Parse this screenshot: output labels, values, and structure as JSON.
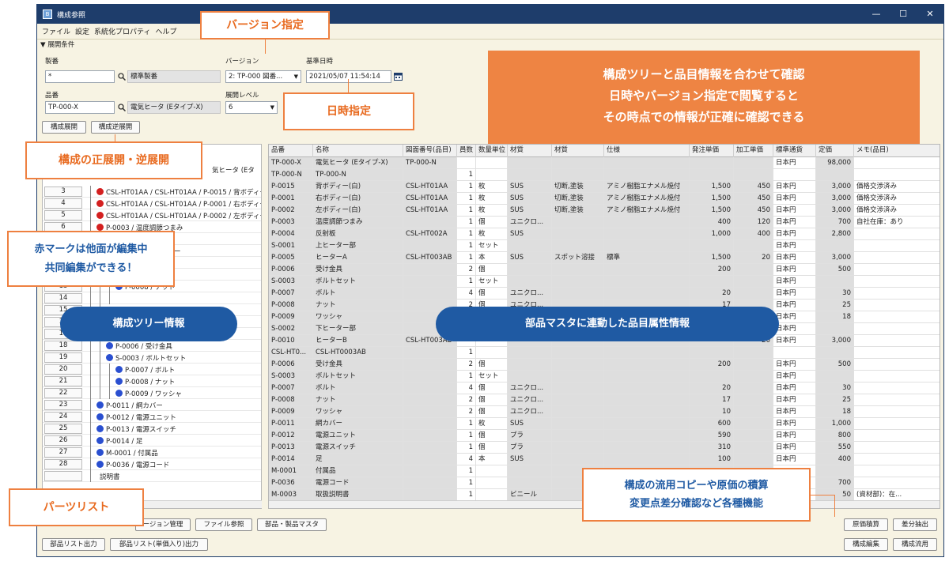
{
  "window": {
    "title": "構成参照",
    "app_icon": "app-icon",
    "controls": [
      "—",
      "☐",
      "✕"
    ]
  },
  "menu": [
    "ファイル",
    "設定",
    "系統化プロパティ",
    "ヘルプ"
  ],
  "filter_section": {
    "header": "▼ 展開条件",
    "seiban_label": "製番",
    "seiban_value": "*",
    "seiban_desc": "標準製番",
    "hinban_label": "品番",
    "hinban_value": "TP-000-X",
    "hinban_desc": "電気ヒータ (Eタイプ-X)",
    "version_label": "バージョン",
    "version_value": "2: TP-000 図番...",
    "date_label": "基準日時",
    "date_value": "2021/05/07 11:54:14",
    "level_label": "展開レベル",
    "level_value": "6",
    "expand_button": "構成展開",
    "reverse_button": "構成逆展開"
  },
  "tree": {
    "partial_header": "気ヒータ (Eタ",
    "rows": [
      {
        "n": "3",
        "indent": 1,
        "icon": "red",
        "text": "CSL-HT01AA / CSL-HT01AA / P-0015 / 背ボディー"
      },
      {
        "n": "4",
        "indent": 1,
        "icon": "red",
        "text": "CSL-HT01AA / CSL-HT01AA / P-0001 / 右ボディー"
      },
      {
        "n": "5",
        "indent": 1,
        "icon": "red",
        "text": "CSL-HT01AA / CSL-HT01AA / P-0002 / 左ボディー"
      },
      {
        "n": "6",
        "indent": 1,
        "icon": "red",
        "text": "P-0003 / 温度調節つまみ"
      },
      {
        "n": "",
        "indent": 1,
        "icon": "",
        "text": "2A / P-0004 / 反射板"
      },
      {
        "n": "",
        "indent": 1,
        "icon": "",
        "text": "HT003AB / P-0005 / ヒー"
      },
      {
        "n": "",
        "indent": 2,
        "icon": "",
        "text": ""
      },
      {
        "n": "12",
        "indent": 3,
        "icon": "blue",
        "text": "P-0007 / ボルト"
      },
      {
        "n": "13",
        "indent": 3,
        "icon": "blue",
        "text": "P-0008 / ナット"
      },
      {
        "n": "14",
        "indent": 3,
        "icon": "",
        "text": ""
      },
      {
        "n": "15",
        "indent": 2,
        "icon": "",
        "text": ""
      },
      {
        "n": "16",
        "indent": 1,
        "icon": "",
        "text": "CSL-HT003AB / P-0010 / ヒー"
      },
      {
        "n": "17",
        "indent": 2,
        "icon": "doc",
        "text": "CSL-HT0003AB(3) / CSL-HT0003AB"
      },
      {
        "n": "18",
        "indent": 2,
        "icon": "blue",
        "text": "P-0006 / 受け金具"
      },
      {
        "n": "19",
        "indent": 2,
        "icon": "blue",
        "text": "S-0003 / ボルトセット"
      },
      {
        "n": "20",
        "indent": 3,
        "icon": "blue",
        "text": "P-0007 / ボルト"
      },
      {
        "n": "21",
        "indent": 3,
        "icon": "blue",
        "text": "P-0008 / ナット"
      },
      {
        "n": "22",
        "indent": 3,
        "icon": "blue",
        "text": "P-0009 / ワッシャ"
      },
      {
        "n": "23",
        "indent": 1,
        "icon": "blue",
        "text": "P-0011 / 網カバー"
      },
      {
        "n": "24",
        "indent": 1,
        "icon": "blue",
        "text": "P-0012 / 電源ユニット"
      },
      {
        "n": "25",
        "indent": 1,
        "icon": "blue",
        "text": "P-0013 / 電源スイッチ"
      },
      {
        "n": "26",
        "indent": 1,
        "icon": "blue",
        "text": "P-0014 / 足"
      },
      {
        "n": "27",
        "indent": 1,
        "icon": "blue",
        "text": "M-0001 / 付属品"
      },
      {
        "n": "28",
        "indent": 1,
        "icon": "blue",
        "text": "P-0036 / 電源コード"
      },
      {
        "n": "",
        "indent": 1,
        "icon": "",
        "text": "説明書"
      }
    ]
  },
  "table": {
    "headers": [
      "品番",
      "名称",
      "図面番号(品目)",
      "員数",
      "数量単位",
      "材質",
      "材質",
      "仕様",
      "発注単価",
      "加工単価",
      "標準通貨",
      "定価",
      "メモ(品目)"
    ],
    "rows": [
      [
        "TP-000-X",
        "電気ヒータ (Eタイプ-X)",
        "TP-000-N",
        "",
        "",
        "",
        "",
        "",
        "",
        "",
        "日本円",
        "98,000",
        ""
      ],
      [
        "TP-000-N",
        "TP-000-N",
        "",
        "1",
        "",
        "",
        "",
        "",
        "",
        "",
        "",
        "",
        ""
      ],
      [
        "P-0015",
        "背ボディー(白)",
        "CSL-HT01AA",
        "1",
        "枚",
        "SUS",
        "切断,塗装",
        "アミノ樹脂エナメル焼付",
        "1,500",
        "450",
        "日本円",
        "3,000",
        "価格交渉済み"
      ],
      [
        "P-0001",
        "右ボディー(白)",
        "CSL-HT01AA",
        "1",
        "枚",
        "SUS",
        "切断,塗装",
        "アミノ樹脂エナメル焼付",
        "1,500",
        "450",
        "日本円",
        "3,000",
        "価格交渉済み"
      ],
      [
        "P-0002",
        "左ボディー(白)",
        "CSL-HT01AA",
        "1",
        "枚",
        "SUS",
        "切断,塗装",
        "アミノ樹脂エナメル焼付",
        "1,500",
        "450",
        "日本円",
        "3,000",
        "価格交渉済み"
      ],
      [
        "P-0003",
        "温度調節つまみ",
        "",
        "1",
        "個",
        "ユニクロ...",
        "",
        "",
        "400",
        "120",
        "日本円",
        "700",
        "自社在庫：あり"
      ],
      [
        "P-0004",
        "反射板",
        "CSL-HT002A",
        "1",
        "枚",
        "SUS",
        "",
        "",
        "1,000",
        "400",
        "日本円",
        "2,800",
        ""
      ],
      [
        "S-0001",
        "上ヒーター部",
        "",
        "1",
        "セット",
        "",
        "",
        "",
        "",
        "",
        "日本円",
        "",
        ""
      ],
      [
        "P-0005",
        "ヒーターA",
        "CSL-HT003AB",
        "1",
        "本",
        "SUS",
        "スポット溶接",
        "標準",
        "1,500",
        "20",
        "日本円",
        "3,000",
        ""
      ],
      [
        "P-0006",
        "受け金具",
        "",
        "2",
        "個",
        "",
        "",
        "",
        "200",
        "",
        "日本円",
        "500",
        ""
      ],
      [
        "S-0003",
        "ボルトセット",
        "",
        "1",
        "セット",
        "",
        "",
        "",
        "",
        "",
        "日本円",
        "",
        ""
      ],
      [
        "P-0007",
        "ボルト",
        "",
        "4",
        "個",
        "ユニクロ...",
        "",
        "",
        "20",
        "",
        "日本円",
        "30",
        ""
      ],
      [
        "P-0008",
        "ナット",
        "",
        "2",
        "個",
        "ユニクロ...",
        "",
        "",
        "17",
        "",
        "日本円",
        "25",
        ""
      ],
      [
        "P-0009",
        "ワッシャ",
        "",
        "2",
        "個",
        "",
        "",
        "",
        "",
        "",
        "日本円",
        "18",
        ""
      ],
      [
        "S-0002",
        "下ヒーター部",
        "",
        "",
        "",
        "",
        "",
        "",
        "",
        "",
        "日本円",
        "",
        ""
      ],
      [
        "P-0010",
        "ヒーターB",
        "CSL-HT003AB",
        "",
        "",
        "",
        "",
        "",
        "",
        "20",
        "日本円",
        "3,000",
        ""
      ],
      [
        "CSL-HT0...",
        "CSL-HT0003AB",
        "",
        "1",
        "",
        "",
        "",
        "",
        "",
        "",
        "",
        "",
        ""
      ],
      [
        "P-0006",
        "受け金具",
        "",
        "2",
        "個",
        "",
        "",
        "",
        "200",
        "",
        "日本円",
        "500",
        ""
      ],
      [
        "S-0003",
        "ボルトセット",
        "",
        "1",
        "セット",
        "",
        "",
        "",
        "",
        "",
        "日本円",
        "",
        ""
      ],
      [
        "P-0007",
        "ボルト",
        "",
        "4",
        "個",
        "ユニクロ...",
        "",
        "",
        "20",
        "",
        "日本円",
        "30",
        ""
      ],
      [
        "P-0008",
        "ナット",
        "",
        "2",
        "個",
        "ユニクロ...",
        "",
        "",
        "17",
        "",
        "日本円",
        "25",
        ""
      ],
      [
        "P-0009",
        "ワッシャ",
        "",
        "2",
        "個",
        "ユニクロ...",
        "",
        "",
        "10",
        "",
        "日本円",
        "18",
        ""
      ],
      [
        "P-0011",
        "網カバー",
        "",
        "1",
        "枚",
        "SUS",
        "",
        "",
        "600",
        "",
        "日本円",
        "1,000",
        ""
      ],
      [
        "P-0012",
        "電源ユニット",
        "",
        "1",
        "個",
        "プラ",
        "",
        "",
        "590",
        "",
        "日本円",
        "800",
        ""
      ],
      [
        "P-0013",
        "電源スイッチ",
        "",
        "1",
        "個",
        "プラ",
        "",
        "",
        "310",
        "",
        "日本円",
        "550",
        ""
      ],
      [
        "P-0014",
        "足",
        "",
        "4",
        "本",
        "SUS",
        "",
        "",
        "100",
        "",
        "日本円",
        "400",
        ""
      ],
      [
        "M-0001",
        "付属品",
        "",
        "1",
        "",
        "",
        "",
        "",
        "",
        "",
        "",
        "",
        ""
      ],
      [
        "P-0036",
        "電源コード",
        "",
        "1",
        "",
        "",
        "",
        "",
        "",
        "",
        "",
        "700",
        ""
      ],
      [
        "M-0003",
        "取扱説明書",
        "",
        "1",
        "",
        "ビニール",
        "",
        "",
        "",
        "",
        "",
        "50",
        "(資材部)：在..."
      ]
    ]
  },
  "bottom_buttons": {
    "version_mgmt": "ージョン管理",
    "file_ref": "ファイル参照",
    "parts_master": "部品・製品マスタ",
    "parts_list_out": "部品リスト出力",
    "parts_list_price_out": "部品リスト(単価入り)出力",
    "cost_calc": "原価積算",
    "diff_extract": "差分抽出",
    "edit_structure": "構成編集",
    "reuse_structure": "構成流用"
  },
  "annotations": {
    "version": "バージョン指定",
    "datetime": "日時指定",
    "expand": "構成の正展開・逆展開",
    "main_line1": "構成ツリーと品目情報を合わせて確認",
    "main_line2": "日時やバージョン指定で閲覧すると",
    "main_line3": "その時点での情報が正確に確認できる",
    "red_line1": "赤マークは他面が編集中",
    "red_line2": "共同編集ができる！",
    "tree_info": "構成ツリー情報",
    "attr_info": "部品マスタに連動した品目属性情報",
    "bottom_line1": "構成の流用コピーや原価の積算",
    "bottom_line2": "変更点差分確認など各種機能",
    "parts_list": "パーツリスト"
  },
  "colors": {
    "accent_orange": "#ee8443",
    "accent_blue": "#1f5aa3",
    "titlebar": "#1e3d6b",
    "window_bg": "#f7f3e3",
    "lock_red": "#d42020",
    "node_blue": "#2a4fd0"
  }
}
